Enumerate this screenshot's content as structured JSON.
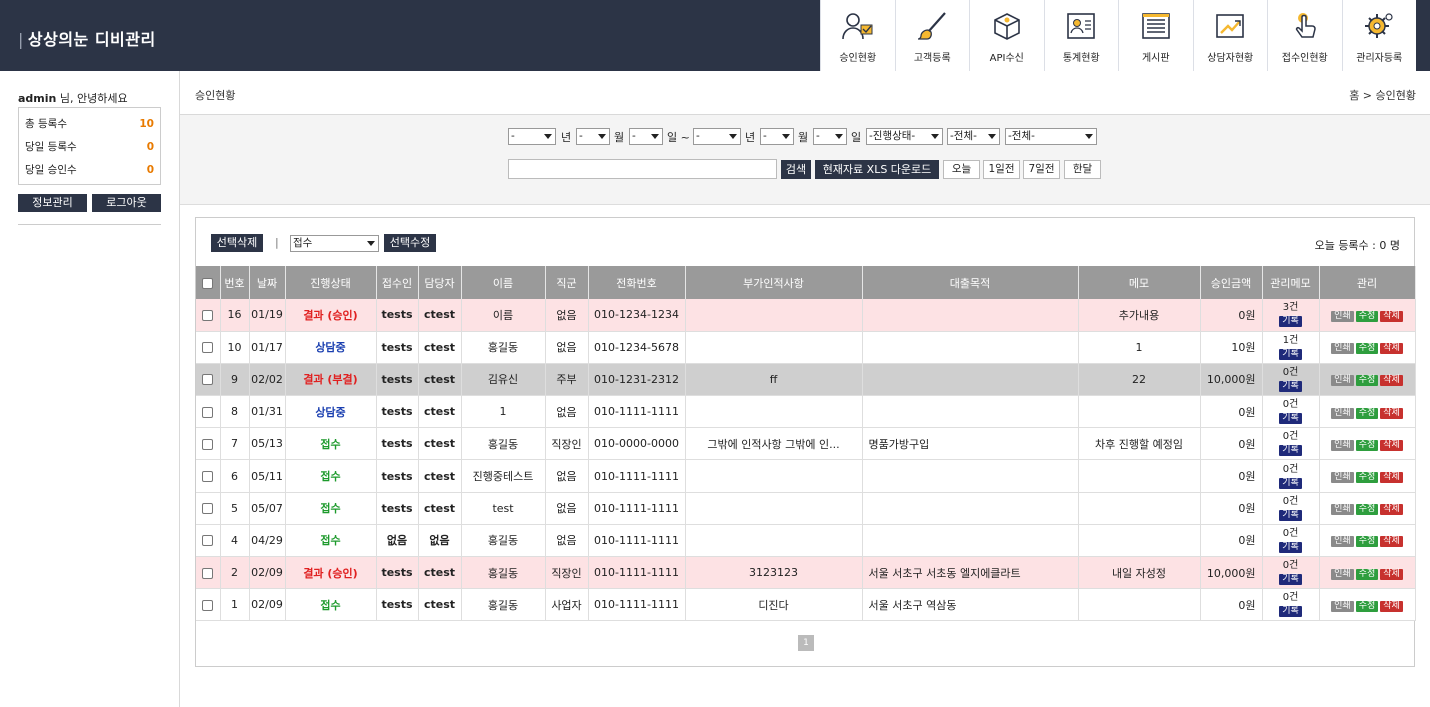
{
  "app": {
    "title_bar": "|",
    "title": "상상의눈 디비관리"
  },
  "nav": [
    {
      "label": "승인현황",
      "icon": "user-approval-icon"
    },
    {
      "label": "고객등록",
      "icon": "brush-icon"
    },
    {
      "label": "API수신",
      "icon": "box-icon"
    },
    {
      "label": "통계현황",
      "icon": "profile-card-icon"
    },
    {
      "label": "게시판",
      "icon": "board-list-icon"
    },
    {
      "label": "상담자현황",
      "icon": "chart-up-icon"
    },
    {
      "label": "접수인현황",
      "icon": "hand-touch-icon"
    },
    {
      "label": "관리자등록",
      "icon": "gear-settings-icon"
    }
  ],
  "sidebar": {
    "user": "admin",
    "greeting_suffix": " 님, 안녕하세요",
    "stats": [
      {
        "label": "총 등록수",
        "value": "10"
      },
      {
        "label": "당일 등록수",
        "value": "0"
      },
      {
        "label": "당일 승인수",
        "value": "0"
      }
    ],
    "info_button": "정보관리",
    "logout_button": "로그아웃"
  },
  "page": {
    "title": "승인현황",
    "breadcrumb": "홈 > 승인현황"
  },
  "filter": {
    "dash": "-",
    "year": "년",
    "month": "월",
    "day": "일 ~",
    "day_end": "일",
    "progress_select": "-진행상태-",
    "all1": "-전체-",
    "all2": "-전체-",
    "search_button": "검색",
    "xls_button": "현재자료 XLS 다운로드",
    "today": "오늘",
    "one_day": "1일전",
    "seven_days": "7일전",
    "one_month": "한달"
  },
  "toolbar": {
    "delete_selected": "선택삭제",
    "pipe": "|",
    "status_value": "접수",
    "modify_selected": "선택수정",
    "today_count": "오늘 등록수 : 0 명"
  },
  "table": {
    "headers": [
      "",
      "번호",
      "날짜",
      "진행상태",
      "접수인",
      "담당자",
      "이름",
      "직군",
      "전화번호",
      "부가인적사항",
      "대출목적",
      "메모",
      "승인금액",
      "관리메모",
      "관리"
    ],
    "record_button": "기록",
    "print_button": "인쇄",
    "edit_button": "수정",
    "delete_button": "삭제",
    "rows": [
      {
        "no": "16",
        "date": "01/19",
        "status": "결과 (승인)",
        "status_color": "#e02020",
        "receiver": "tests",
        "manager": "ctest",
        "name": "이름",
        "job": "없음",
        "phone": "010-1234-1234",
        "extra": "",
        "purpose": "",
        "memo": "추가내용",
        "amount": "0원",
        "memo_count": "3건",
        "bg": "#fde2e4"
      },
      {
        "no": "10",
        "date": "01/17",
        "status": "상담중",
        "status_color": "#1a3fb0",
        "receiver": "tests",
        "manager": "ctest",
        "name": "홍길동",
        "job": "없음",
        "phone": "010-1234-5678",
        "extra": "",
        "purpose": "",
        "memo": "1",
        "amount": "10원",
        "memo_count": "1건",
        "bg": "#ffffff"
      },
      {
        "no": "9",
        "date": "02/02",
        "status": "결과 (부결)",
        "status_color": "#e02020",
        "receiver": "tests",
        "manager": "ctest",
        "name": "김유신",
        "job": "주부",
        "phone": "010-1231-2312",
        "extra": "ff",
        "purpose": "",
        "memo": "22",
        "amount": "10,000원",
        "memo_count": "0건",
        "bg": "#cfcfcf"
      },
      {
        "no": "8",
        "date": "01/31",
        "status": "상담중",
        "status_color": "#1a3fb0",
        "receiver": "tests",
        "manager": "ctest",
        "name": "1",
        "job": "없음",
        "phone": "010-1111-1111",
        "extra": "",
        "purpose": "",
        "memo": "",
        "amount": "0원",
        "memo_count": "0건",
        "bg": "#ffffff"
      },
      {
        "no": "7",
        "date": "05/13",
        "status": "접수",
        "status_color": "#1d9a2c",
        "receiver": "tests",
        "manager": "ctest",
        "name": "홍길동",
        "job": "직장인",
        "phone": "010-0000-0000",
        "extra": "그밖에 인적사항 그밖에 인...",
        "purpose": "명품가방구입",
        "memo": "차후 진행할 예정임",
        "amount": "0원",
        "memo_count": "0건",
        "bg": "#ffffff"
      },
      {
        "no": "6",
        "date": "05/11",
        "status": "접수",
        "status_color": "#1d9a2c",
        "receiver": "tests",
        "manager": "ctest",
        "name": "진행중테스트",
        "job": "없음",
        "phone": "010-1111-1111",
        "extra": "",
        "purpose": "",
        "memo": "",
        "amount": "0원",
        "memo_count": "0건",
        "bg": "#ffffff"
      },
      {
        "no": "5",
        "date": "05/07",
        "status": "접수",
        "status_color": "#1d9a2c",
        "receiver": "tests",
        "manager": "ctest",
        "name": "test",
        "job": "없음",
        "phone": "010-1111-1111",
        "extra": "",
        "purpose": "",
        "memo": "",
        "amount": "0원",
        "memo_count": "0건",
        "bg": "#ffffff"
      },
      {
        "no": "4",
        "date": "04/29",
        "status": "접수",
        "status_color": "#1d9a2c",
        "receiver": "없음",
        "manager": "없음",
        "name": "홍길동",
        "job": "없음",
        "phone": "010-1111-1111",
        "extra": "",
        "purpose": "",
        "memo": "",
        "amount": "0원",
        "memo_count": "0건",
        "bg": "#ffffff"
      },
      {
        "no": "2",
        "date": "02/09",
        "status": "결과 (승인)",
        "status_color": "#e02020",
        "receiver": "tests",
        "manager": "ctest",
        "name": "홍길동",
        "job": "직장인",
        "phone": "010-1111-1111",
        "extra": "3123123",
        "purpose": "서울 서초구 서초동 엘지에클라트",
        "memo": "내일 자성정",
        "amount": "10,000원",
        "memo_count": "0건",
        "bg": "#fde2e4"
      },
      {
        "no": "1",
        "date": "02/09",
        "status": "접수",
        "status_color": "#1d9a2c",
        "receiver": "tests",
        "manager": "ctest",
        "name": "홍길동",
        "job": "사업자",
        "phone": "010-1111-1111",
        "extra": "디진다",
        "purpose": "서울 서초구 역삼동",
        "memo": "",
        "amount": "0원",
        "memo_count": "0건",
        "bg": "#ffffff"
      }
    ]
  },
  "pagination": {
    "current": "1"
  }
}
